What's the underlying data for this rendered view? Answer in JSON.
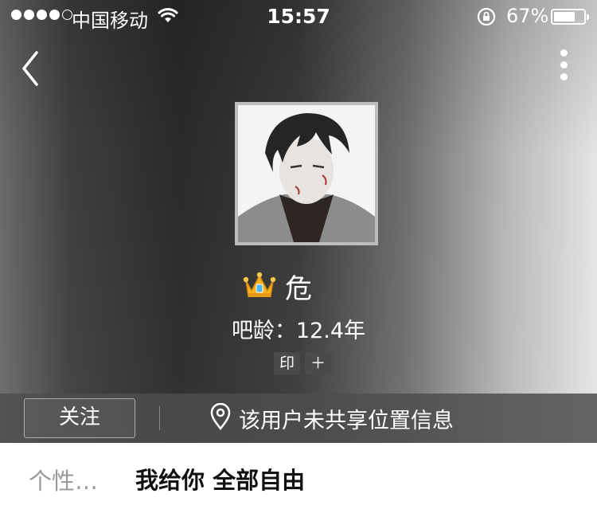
{
  "status_bar": {
    "carrier": "中国移动",
    "time": "15:57",
    "battery": "67%",
    "signal_bars": 4,
    "signal_total": 5,
    "battery_level": 0.67
  },
  "nav": {
    "back_icon": "chevron-left-icon",
    "more_icon": "more-vertical-icon"
  },
  "profile": {
    "avatar_icon": "user-avatar",
    "crown_icon": "crown-icon",
    "username": "危",
    "tieba_age": "吧龄：12.4年",
    "badges": [
      "印",
      "＋"
    ]
  },
  "actions": {
    "follow_label": "关注",
    "location_icon": "location-pin-icon",
    "location_text": "该用户未共享位置信息"
  },
  "bio": {
    "label": "个性…",
    "text": "我给你 全部自由"
  },
  "colors": {
    "bar": "#4e4e4e",
    "text_light": "#ffffff",
    "bio_label": "#9a9a9a"
  }
}
